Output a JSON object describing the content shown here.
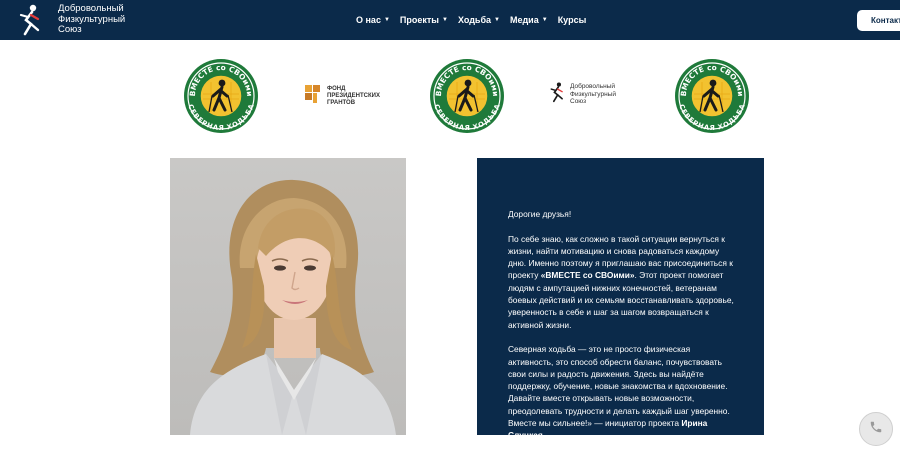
{
  "header": {
    "logo_lines": [
      "Добровольный",
      "Физкультурный",
      "Союз"
    ],
    "nav": [
      {
        "label": "О нас",
        "has_dropdown": true
      },
      {
        "label": "Проекты",
        "has_dropdown": true
      },
      {
        "label": "Ходьба",
        "has_dropdown": true
      },
      {
        "label": "Медиа",
        "has_dropdown": true
      },
      {
        "label": "Курсы",
        "has_dropdown": false
      }
    ],
    "contacts_label": "Контакт"
  },
  "logos": {
    "badge": {
      "top_text": "ВМЕСТЕ со СВОими",
      "bottom_text": "СЕВЕРНАЯ ХОДЬБА"
    },
    "fpg_lines": [
      "ФОНД",
      "ПРЕЗИДЕНТСКИХ",
      "ГРАНТОВ"
    ],
    "dfs_lines": [
      "Добровольный",
      "Физкультурный",
      "Союз"
    ]
  },
  "panel": {
    "greeting": "Дорогие друзья!",
    "p1_a": "По себе знаю, как сложно в такой ситуации вернуться к жизни, найти мотивацию и снова радоваться каждому дню. Именно поэтому я приглашаю вас присоединиться к проекту ",
    "p1_project": "«ВМЕСТЕ со СВОими»",
    "p1_b": ". Этот проект помогает людям с ампутацией нижних конечностей, ветеранам боевых действий и их семьям восстанавливать здоровье, уверенность в себе и шаг за шагом возвращаться к активной жизни.",
    "p2": "Северная ходьба — это не просто физическая активность, это способ обрести баланс, почувствовать свои силы и радость движения. Здесь вы найдёте поддержку, обучение, новые знакомства и вдохновение.",
    "p3": "Давайте вместе открывать новые возможности, преодолевать трудности и делать каждый шаг уверенно.",
    "p4_a": "Вместе мы сильнее!» — инициатор проекта ",
    "p4_name": "Ирина Слуцкая"
  },
  "colors": {
    "navy": "#0b2a4a",
    "badge_green": "#1f7a3a",
    "badge_yellow": "#f2c230"
  }
}
